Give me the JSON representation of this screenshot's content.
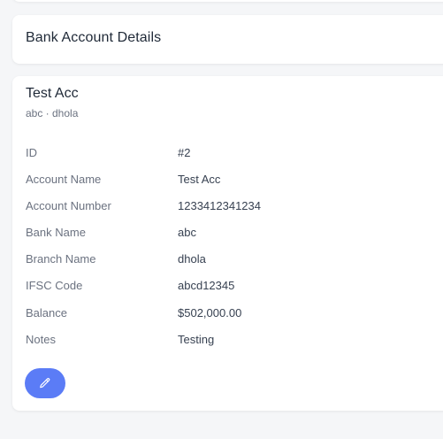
{
  "header": {
    "title": "Bank Account Details"
  },
  "account": {
    "title": "Test Acc",
    "subtitle": "abc · dhola",
    "fields": [
      {
        "label": "ID",
        "value": "#2"
      },
      {
        "label": "Account Name",
        "value": "Test Acc"
      },
      {
        "label": "Account Number",
        "value": "1233412341234"
      },
      {
        "label": "Bank Name",
        "value": "abc"
      },
      {
        "label": "Branch Name",
        "value": "dhola"
      },
      {
        "label": "IFSC Code",
        "value": "abcd12345"
      },
      {
        "label": "Balance",
        "value": "$502,000.00"
      },
      {
        "label": "Notes",
        "value": "Testing"
      }
    ]
  },
  "actions": {
    "edit_icon": "pencil-icon",
    "accent_color": "#5b7cf6"
  }
}
